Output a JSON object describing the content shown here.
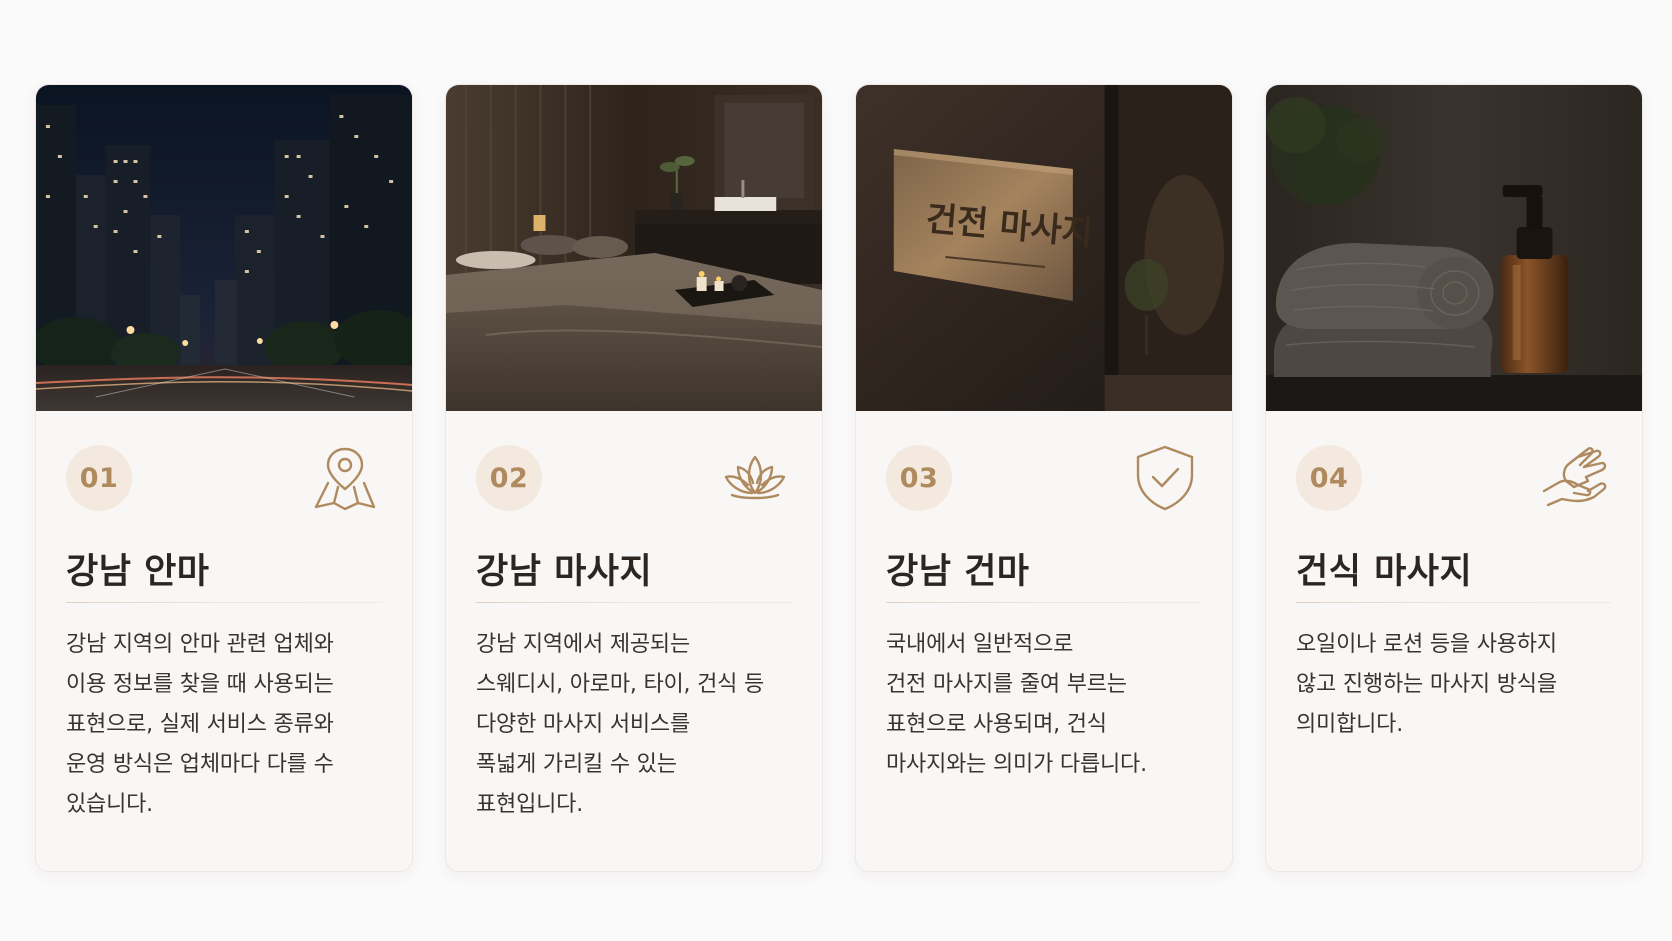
{
  "colors": {
    "accent": "#b08a5f",
    "badge_bg": "#f4e9de",
    "title": "#2c2623",
    "text": "#3a3430",
    "card_bg": "#f8f7f6",
    "page_bg": "#fbfafa"
  },
  "cards": [
    {
      "number": "01",
      "icon": "map-pin-icon",
      "image": "night-city-street-image",
      "title": "강남 안마",
      "description": "강남 지역의 안마 관련 업체와\n이용 정보를 찾을 때 사용되는\n표현으로, 실제 서비스 종류와\n운영 방식은 업체마다 다를 수\n있습니다."
    },
    {
      "number": "02",
      "icon": "lotus-icon",
      "image": "spa-treatment-room-image",
      "title": "강남 마사지",
      "description": "강남 지역에서 제공되는\n스웨디시, 아로마, 타이, 건식 등\n다양한 마사지 서비스를\n폭넓게 가리킬 수 있는\n표현입니다."
    },
    {
      "number": "03",
      "icon": "shield-check-icon",
      "image": "signboard-image",
      "image_text": "건전 마사지",
      "title": "강남 건마",
      "description": "국내에서 일반적으로\n건전 마사지를 줄여 부르는\n표현으로 사용되며, 건식\n마사지와는 의미가 다릅니다."
    },
    {
      "number": "04",
      "icon": "hand-massage-icon",
      "image": "towel-and-oil-bottle-image",
      "title": "건식 마사지",
      "description": "오일이나 로션 등을 사용하지\n않고 진행하는 마사지 방식을\n의미합니다."
    }
  ]
}
